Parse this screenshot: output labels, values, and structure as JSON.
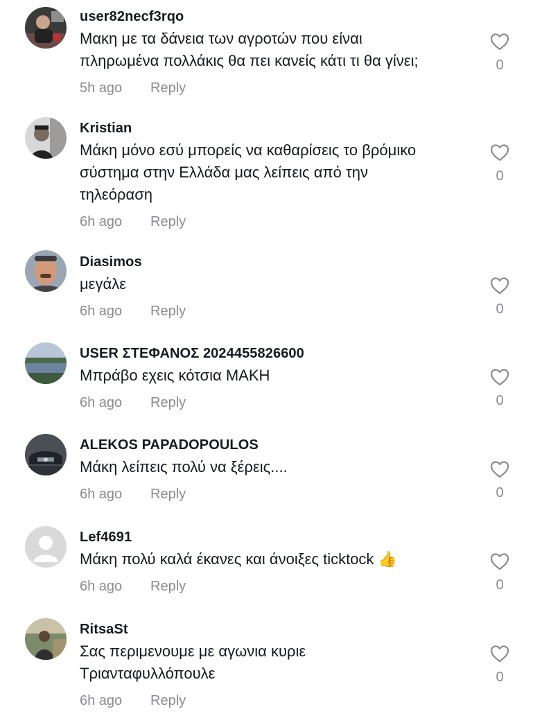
{
  "comments": [
    {
      "username": "user82necf3rqo",
      "text_lines": [
        "Μακη με τα δάνεια των αγροτών που είναι",
        "πληρωμένα πολλάκις θα πει κανείς κάτι τι θα γίνει;"
      ],
      "time": "5h ago",
      "reply_label": "Reply",
      "likes": "0",
      "avatar": "photo-man-dark"
    },
    {
      "username": "Kristian",
      "text_lines": [
        "Μάκη μόνο εσύ μπορείς να καθαρίσεις το βρόμικο",
        "σύστημα στην Ελλάδα μας λείπεις από την",
        "τηλεόραση"
      ],
      "time": "6h ago",
      "reply_label": "Reply",
      "likes": "0",
      "avatar": "photo-man-grey"
    },
    {
      "username": "Diasimos",
      "text_lines": [
        "μεγάλε"
      ],
      "time": "6h ago",
      "reply_label": "Reply",
      "likes": "0",
      "avatar": "photo-man-face"
    },
    {
      "username": "USER ΣΤΕΦΑΝΟΣ 2024455826600",
      "text_lines": [
        "Μπράβο εχεις κότσια ΜΑΚΗ"
      ],
      "time": "6h ago",
      "reply_label": "Reply",
      "likes": "0",
      "avatar": "photo-lake"
    },
    {
      "username": "ALEKOS PAPADOPOULOS",
      "text_lines": [
        "Μάκη λείπεις πολύ να ξέρεις...."
      ],
      "time": "6h ago",
      "reply_label": "Reply",
      "likes": "0",
      "avatar": "photo-car"
    },
    {
      "username": "Lef4691",
      "text_lines": [
        "Μάκη πολύ καλά έκανες και άνοιξες ticktock 👍"
      ],
      "time": "6h ago",
      "reply_label": "Reply",
      "likes": "0",
      "avatar": "default-avatar"
    },
    {
      "username": "RitsaSt",
      "text_lines": [
        "Σας περιμενουμε με αγωνια κυριε",
        "Τριανταφυλλόπουλε"
      ],
      "time": "6h ago",
      "reply_label": "Reply",
      "likes": "0",
      "avatar": "photo-outdoor"
    }
  ],
  "colors": {
    "text": "#161823",
    "muted": "#8a8b91"
  }
}
